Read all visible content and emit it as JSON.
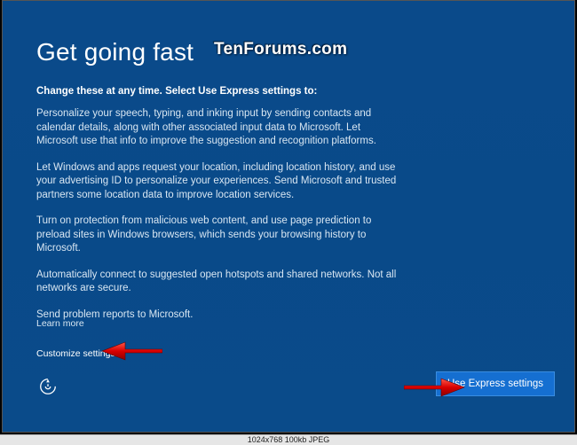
{
  "heading": "Get going fast",
  "watermark": "TenForums.com",
  "subhead": "Change these at any time. Select Use Express settings to:",
  "paragraphs": [
    "Personalize your speech, typing, and inking input by sending contacts and calendar details, along with other associated input data to Microsoft. Let Microsoft use that info to improve the suggestion and recognition platforms.",
    "Let Windows and apps request your location, including location history, and use your advertising ID to personalize your experiences. Send Microsoft and trusted partners some location data to improve location services.",
    "Turn on protection from malicious web content, and use page prediction to preload sites in Windows browsers, which sends your browsing history to Microsoft.",
    "Automatically connect to suggested open hotspots and shared networks. Not all networks are secure.",
    "Send problem reports to Microsoft."
  ],
  "learn_more": "Learn more",
  "customize": "Customize settings",
  "express_button": "Use Express settings",
  "infobar": "1024x768   100kb   JPEG"
}
